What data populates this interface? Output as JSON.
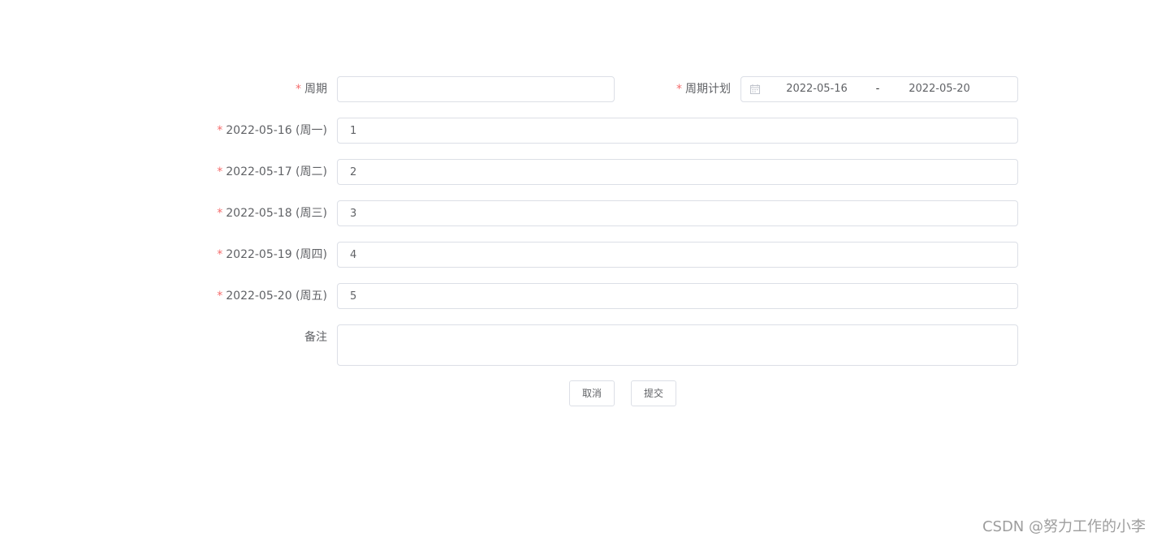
{
  "form": {
    "period": {
      "required_mark": "*",
      "label": "周期",
      "value": ""
    },
    "period_plan": {
      "required_mark": "*",
      "label": "周期计划",
      "start": "2022-05-16",
      "separator": "-",
      "end": "2022-05-20"
    },
    "days": [
      {
        "required_mark": "*",
        "label": "2022-05-16 (周一)",
        "value": "1"
      },
      {
        "required_mark": "*",
        "label": "2022-05-17 (周二)",
        "value": "2"
      },
      {
        "required_mark": "*",
        "label": "2022-05-18 (周三)",
        "value": "3"
      },
      {
        "required_mark": "*",
        "label": "2022-05-19 (周四)",
        "value": "4"
      },
      {
        "required_mark": "*",
        "label": "2022-05-20 (周五)",
        "value": "5"
      }
    ],
    "remark": {
      "label": "备注",
      "value": ""
    },
    "buttons": {
      "cancel": "取消",
      "submit": "提交"
    }
  },
  "watermark": "CSDN @努力工作的小李",
  "colors": {
    "required": "#f56c6c",
    "border": "#dcdfe6",
    "text": "#606266"
  },
  "icons": {
    "date_range": "calendar-icon"
  }
}
